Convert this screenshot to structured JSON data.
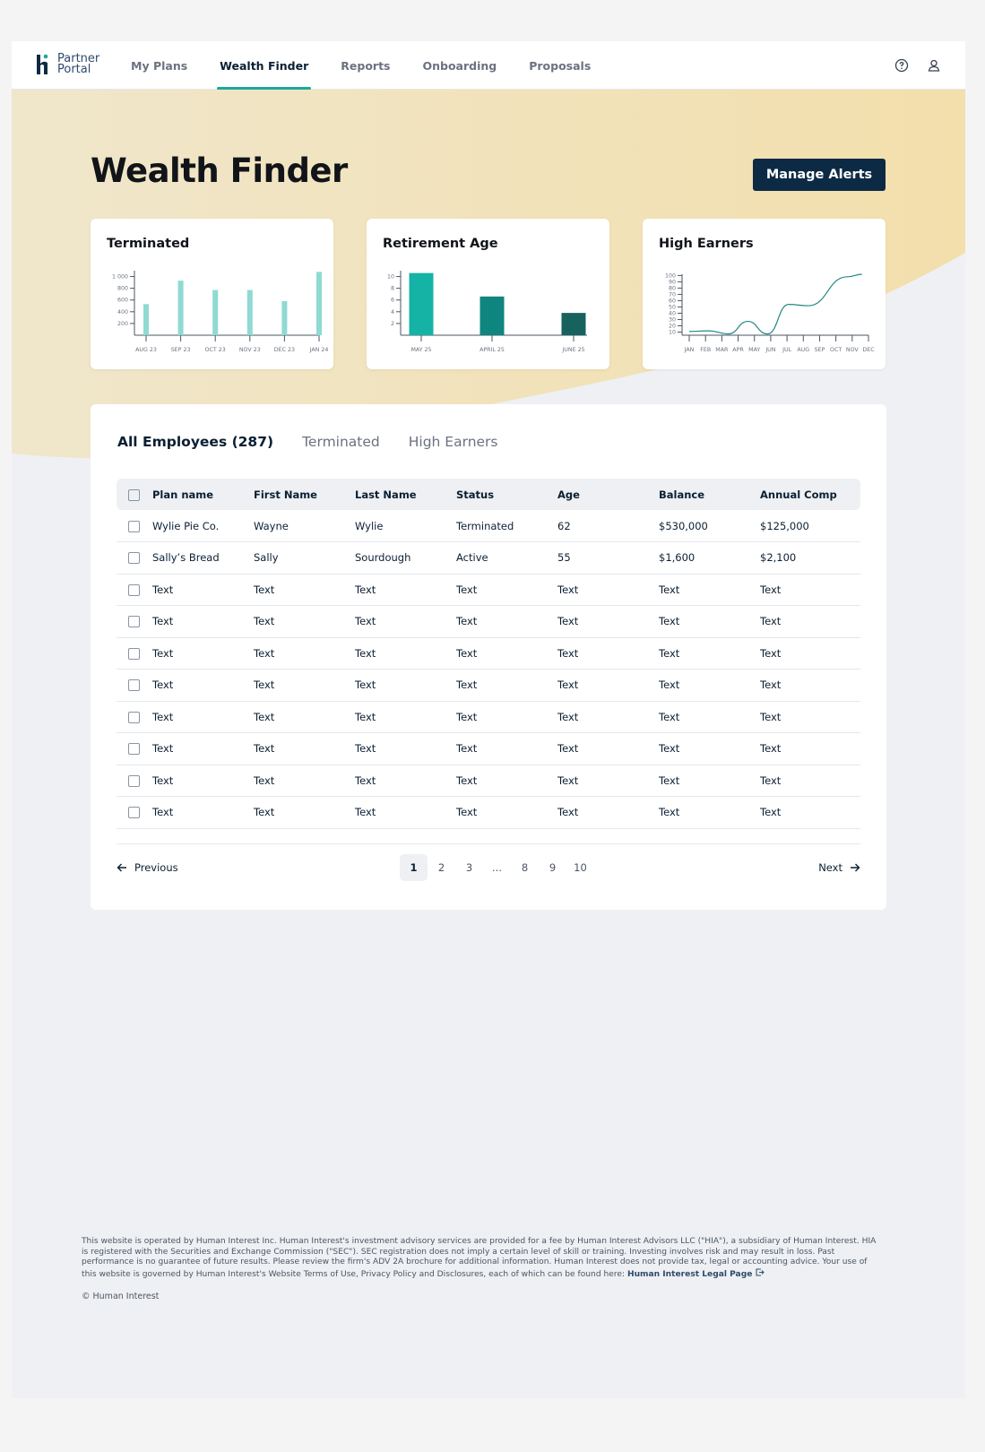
{
  "logo": {
    "line1": "Partner",
    "line2": "Portal"
  },
  "nav": {
    "items": [
      {
        "label": "My Plans",
        "active": false
      },
      {
        "label": "Wealth Finder",
        "active": true
      },
      {
        "label": "Reports",
        "active": false
      },
      {
        "label": "Onboarding",
        "active": false
      },
      {
        "label": "Proposals",
        "active": false
      }
    ],
    "icons": [
      "help-circle-icon",
      "user-icon"
    ]
  },
  "page": {
    "title": "Wealth Finder",
    "manage_alerts_label": "Manage Alerts"
  },
  "cards": {
    "terminated": {
      "title": "Terminated"
    },
    "retirement": {
      "title": "Retirement Age"
    },
    "high_earners": {
      "title": "High Earners"
    }
  },
  "chart_data": [
    {
      "type": "bar",
      "categories": [
        "AUG 23",
        "SEP 23",
        "OCT 23",
        "NOV 23",
        "DEC 23",
        "JAN 24"
      ],
      "values": [
        530,
        930,
        770,
        770,
        580,
        1080
      ],
      "yticks": [
        200,
        400,
        600,
        800,
        1000
      ],
      "yticklabels": [
        "200",
        "400",
        "600",
        "800",
        "1 000"
      ],
      "ylim": [
        0,
        1100
      ],
      "color": "#8fdad3"
    },
    {
      "type": "bar",
      "categories": [
        "MAY 25",
        "APRIL 25",
        "JUNE 25"
      ],
      "values": [
        10.6,
        6.6,
        3.8
      ],
      "colors": [
        "#14b3a6",
        "#0e857e",
        "#17615f"
      ],
      "yticks": [
        2,
        4,
        6,
        8,
        10
      ],
      "yticklabels": [
        "2",
        "4",
        "6",
        "8",
        "10"
      ],
      "ylim": [
        0,
        11
      ]
    },
    {
      "type": "line",
      "categories": [
        "JAN",
        "FEB",
        "MAR",
        "APR",
        "MAY",
        "JUN",
        "JUL",
        "AUG",
        "SEP",
        "OCT",
        "NOV",
        "DEC"
      ],
      "values": [
        11,
        12,
        7,
        27,
        7,
        54,
        52,
        98,
        102
      ],
      "x": [
        0,
        1.2,
        2.4,
        3.6,
        4.8,
        6.1,
        7.3,
        9.7,
        10.6
      ],
      "yticks": [
        10,
        20,
        30,
        40,
        50,
        60,
        70,
        80,
        90,
        100
      ],
      "yticklabels": [
        "10",
        "20",
        "30",
        "40",
        "50",
        "60",
        "70",
        "80",
        "90",
        "100"
      ],
      "ylim": [
        5,
        102
      ],
      "color": "#1f8a80"
    }
  ],
  "table": {
    "tabs": [
      {
        "label": "All Employees (287)",
        "active": true
      },
      {
        "label": "Terminated",
        "active": false
      },
      {
        "label": "High Earners",
        "active": false
      }
    ],
    "columns": [
      "Plan name",
      "First Name",
      "Last Name",
      "Status",
      "Age",
      "Balance",
      "Annual Comp"
    ],
    "rows": [
      [
        "Wylie Pie Co.",
        "Wayne",
        "Wylie",
        "Terminated",
        "62",
        "$530,000",
        "$125,000"
      ],
      [
        "Sally’s Bread",
        "Sally",
        "Sourdough",
        "Active",
        "55",
        "$1,600",
        "$2,100"
      ],
      [
        "Text",
        "Text",
        "Text",
        "Text",
        "Text",
        "Text",
        "Text"
      ],
      [
        "Text",
        "Text",
        "Text",
        "Text",
        "Text",
        "Text",
        "Text"
      ],
      [
        "Text",
        "Text",
        "Text",
        "Text",
        "Text",
        "Text",
        "Text"
      ],
      [
        "Text",
        "Text",
        "Text",
        "Text",
        "Text",
        "Text",
        "Text"
      ],
      [
        "Text",
        "Text",
        "Text",
        "Text",
        "Text",
        "Text",
        "Text"
      ],
      [
        "Text",
        "Text",
        "Text",
        "Text",
        "Text",
        "Text",
        "Text"
      ],
      [
        "Text",
        "Text",
        "Text",
        "Text",
        "Text",
        "Text",
        "Text"
      ],
      [
        "Text",
        "Text",
        "Text",
        "Text",
        "Text",
        "Text",
        "Text"
      ]
    ]
  },
  "pagination": {
    "previous_label": "Previous",
    "next_label": "Next",
    "pages": [
      "1",
      "2",
      "3",
      "...",
      "8",
      "9",
      "10"
    ],
    "current": "1"
  },
  "footer": {
    "disclaimer": "This website is operated by Human Interest Inc. Human Interest's investment advisory services are provided for a fee by Human Interest Advisors LLC (\"HIA\"), a subsidiary of Human Interest. HIA is registered with the Securities and Exchange Commission (\"SEC\"). SEC registration does not imply a certain level of skill or training. Investing involves risk and may result in loss. Past performance is no guarantee of future results. Please review the firm's ADV 2A brochure for additional information. Human Interest does not provide tax, legal or accounting advice. Your use of this website is governed by Human Interest's Website Terms of Use, Privacy Policy and Disclosures, each of which can be found here:",
    "legal_link": "Human Interest Legal Page",
    "copyright": "© Human Interest"
  },
  "colors": {
    "accent": "#1ba89b",
    "navy": "#0d2a45",
    "background_warm": "#f3e3b6"
  }
}
